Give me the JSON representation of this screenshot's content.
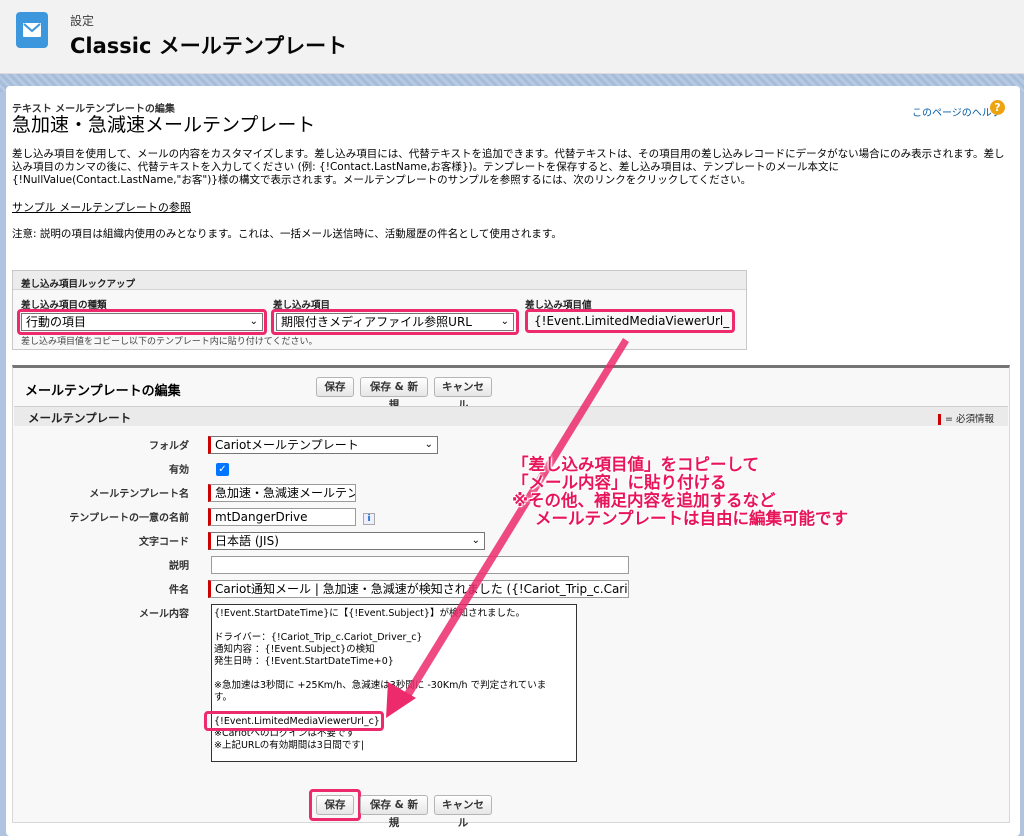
{
  "header": {
    "subtitle": "設定",
    "title": "Classic メールテンプレート",
    "icon": "email-icon"
  },
  "page": {
    "small_title": "テキスト メールテンプレートの編集",
    "title": "急加速・急減速メールテンプレート",
    "help_link": "このページのヘルプ"
  },
  "intro": "差し込み項目を使用して、メールの内容をカスタマイズします。差し込み項目には、代替テキストを追加できます。代替テキストは、その項目用の差し込みレコードにデータがない場合にのみ表示されます。差し込み項目のカンマの後に、代替テキストを入力してください (例: {!Contact.LastName,お客様})。テンプレートを保存すると、差し込み項目は、テンプレートのメール本文に {!NullValue(Contact.LastName,\"お客\")}様の構文で表示されます。メールテンプレートのサンプルを参照するには、次のリンクをクリックしてください。",
  "sample_link": "サンプル メールテンプレートの参照",
  "note": "注意: 説明の項目は組織内使用のみとなります。これは、一括メール送信時に、活動履歴の件名として使用されます。",
  "lookup": {
    "title": "差し込み項目ルックアップ",
    "type_label": "差し込み項目の種類",
    "type_value": "行動の項目",
    "field_label": "差し込み項目",
    "field_value": "期限付きメディアファイル参照URL",
    "value_label": "差し込み項目値",
    "value": "{!Event.LimitedMediaViewerUrl_c}",
    "note": "差し込み項目値をコピーし以下のテンプレート内に貼り付けてください。"
  },
  "edit": {
    "title": "メールテンプレートの編集",
    "save": "保存",
    "save_new": "保存 & 新規",
    "cancel": "キャンセル",
    "section": "メールテンプレート",
    "required": "= 必須情報"
  },
  "form": {
    "folder_label": "フォルダ",
    "folder": "Cariotメールテンプレート",
    "active_label": "有効",
    "name_label": "メールテンプレート名",
    "name": "急加速・急減速メールテンプ",
    "unique_label": "テンプレートの一意の名前",
    "unique": "mtDangerDrive",
    "encoding_label": "文字コード",
    "encoding": "日本語 (JIS)",
    "desc_label": "説明",
    "desc": "",
    "subject_label": "件名",
    "subject": "Cariot通知メール | 急加速・急減速が検知されました ({!Cariot_Trip_c.Cariot_",
    "body_label": "メール内容",
    "body": "{!Event.StartDateTime}に【{!Event.Subject}】が検知されました。\n\nドライバー：{!Cariot_Trip_c.Cariot_Driver_c}\n通知内容 ：{!Event.Subject}の検知\n発生日時 ：{!Event.StartDateTime+0}\n\n※急加速は3秒間に +25Km/h、急減速は3秒間に -30Km/h で判定されていま\nす。\n\n{!Event.LimitedMediaViewerUrl_c}\n※Cariotへのログインは不要です\n※上記URLの有効期間は3日間です|"
  },
  "callout": "「差し込み項目値」をコピーして\n「メール内容」に貼り付ける\n※その他、補足内容を追加するなど\n    メールテンプレートは自由に編集可能です",
  "colors": {
    "highlight": "#ec2a6c",
    "brand": "#3c97dd"
  }
}
